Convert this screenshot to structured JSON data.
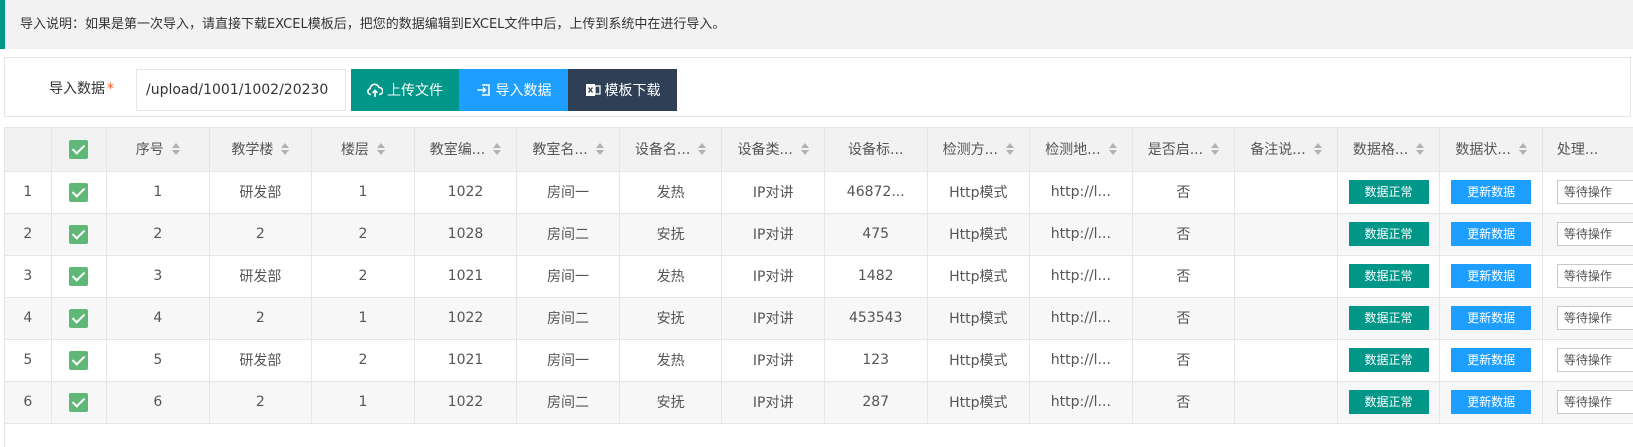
{
  "notice": "导入说明：如果是第一次导入，请直接下载EXCEL模板后，把您的数据编辑到EXCEL文件中后，上传到系统中在进行导入。",
  "form": {
    "label": "导入数据",
    "required_mark": "*",
    "path_value": "/upload/1001/1002/20230",
    "upload_label": "上传文件",
    "import_label": "导入数据",
    "template_label": "模板下载"
  },
  "table": {
    "headers": [
      "序号",
      "教学楼",
      "楼层",
      "教室编...",
      "教室名...",
      "设备名...",
      "设备类...",
      "设备标...",
      "检测方...",
      "检测地...",
      "是否启...",
      "备注说...",
      "数据格...",
      "数据状...",
      "处理..."
    ],
    "rows": [
      {
        "idx": "1",
        "seq": "1",
        "building": "研发部",
        "floor": "1",
        "room_no": "1022",
        "room_name": "房间一",
        "device_name": "发热",
        "device_type": "IP对讲",
        "device_tag": "46872...",
        "method": "Http模式",
        "addr": "http://l...",
        "enabled": "否",
        "remark": "",
        "format": "数据正常",
        "status": "更新数据",
        "action": "等待操作"
      },
      {
        "idx": "2",
        "seq": "2",
        "building": "2",
        "floor": "2",
        "room_no": "1028",
        "room_name": "房间二",
        "device_name": "安抚",
        "device_type": "IP对讲",
        "device_tag": "475",
        "method": "Http模式",
        "addr": "http://l...",
        "enabled": "否",
        "remark": "",
        "format": "数据正常",
        "status": "更新数据",
        "action": "等待操作"
      },
      {
        "idx": "3",
        "seq": "3",
        "building": "研发部",
        "floor": "2",
        "room_no": "1021",
        "room_name": "房间一",
        "device_name": "发热",
        "device_type": "IP对讲",
        "device_tag": "1482",
        "method": "Http模式",
        "addr": "http://l...",
        "enabled": "否",
        "remark": "",
        "format": "数据正常",
        "status": "更新数据",
        "action": "等待操作"
      },
      {
        "idx": "4",
        "seq": "4",
        "building": "2",
        "floor": "1",
        "room_no": "1022",
        "room_name": "房间二",
        "device_name": "安抚",
        "device_type": "IP对讲",
        "device_tag": "453543",
        "method": "Http模式",
        "addr": "http://l...",
        "enabled": "否",
        "remark": "",
        "format": "数据正常",
        "status": "更新数据",
        "action": "等待操作"
      },
      {
        "idx": "5",
        "seq": "5",
        "building": "研发部",
        "floor": "2",
        "room_no": "1021",
        "room_name": "房间一",
        "device_name": "发热",
        "device_type": "IP对讲",
        "device_tag": "123",
        "method": "Http模式",
        "addr": "http://l...",
        "enabled": "否",
        "remark": "",
        "format": "数据正常",
        "status": "更新数据",
        "action": "等待操作"
      },
      {
        "idx": "6",
        "seq": "6",
        "building": "2",
        "floor": "1",
        "room_no": "1022",
        "room_name": "房间二",
        "device_name": "安抚",
        "device_type": "IP对讲",
        "device_tag": "287",
        "method": "Http模式",
        "addr": "http://l...",
        "enabled": "否",
        "remark": "",
        "format": "数据正常",
        "status": "更新数据",
        "action": "等待操作"
      }
    ]
  },
  "colors": {
    "primary": "#009688",
    "blue": "#1e9fff",
    "dark": "#2f4056",
    "checkbox": "#5fb878",
    "required": "#ff5722"
  },
  "icons": {
    "upload": "cloud-upload-icon",
    "import": "import-icon",
    "template": "excel-icon"
  }
}
